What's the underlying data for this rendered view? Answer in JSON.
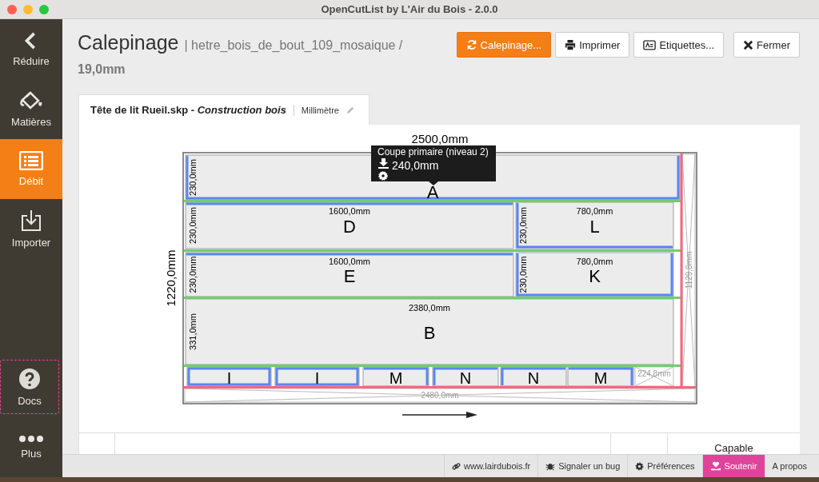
{
  "window": {
    "title": "OpenCutList by L'Air du Bois - 2.0.0"
  },
  "sidebar": {
    "items": [
      {
        "label": "Réduire",
        "kind": "chevron",
        "selected": false,
        "outlined": false
      },
      {
        "label": "Matières",
        "kind": "bucket",
        "selected": false,
        "outlined": false
      },
      {
        "label": "Débit",
        "kind": "list",
        "selected": true,
        "outlined": false
      },
      {
        "label": "Importer",
        "kind": "import",
        "selected": false,
        "outlined": false
      },
      {
        "label": "Docs",
        "kind": "help",
        "selected": false,
        "outlined": true
      },
      {
        "label": "Plus",
        "kind": "dots",
        "selected": false,
        "outlined": false
      }
    ]
  },
  "header": {
    "title": "Calepinage",
    "subtitle": "| hetre_bois_de_bout_109_mosaique /",
    "thickness": "19,0mm"
  },
  "buttons": [
    {
      "label": "Calepinage...",
      "kind": "refresh",
      "primary": true
    },
    {
      "label": "Imprimer",
      "kind": "print",
      "primary": false
    },
    {
      "label": "Etiquettes...",
      "kind": "tag",
      "primary": false
    },
    {
      "label": "Fermer",
      "kind": "close",
      "primary": false
    }
  ],
  "tab": {
    "title": "Tête de lit Rueil.skp - *Construction bois*",
    "units": "Millimètre"
  },
  "diagram": {
    "sheet_length": "2500,0mm",
    "sheet_width": "1220,0mm",
    "parts": [
      {
        "letter": "A",
        "width": "230,0mm",
        "band_top": false,
        "band_right": true,
        "band_bottom": true,
        "band_left": true
      },
      {
        "letter": "D",
        "length": "1600,0mm",
        "width": "230,0mm",
        "band_top": true,
        "band_right": false,
        "band_bottom": false,
        "band_left": false
      },
      {
        "letter": "L",
        "length": "780,0mm",
        "width": "230,0mm",
        "band_top": false,
        "band_right": false,
        "band_bottom": true,
        "band_left": true
      },
      {
        "letter": "E",
        "length": "1600,0mm",
        "width": "230,0mm",
        "band_top": true,
        "band_right": false,
        "band_bottom": false,
        "band_left": false
      },
      {
        "letter": "K",
        "length": "780,0mm",
        "width": "230,0mm",
        "band_top": false,
        "band_right": true,
        "band_bottom": true,
        "band_left": true
      },
      {
        "letter": "B",
        "length": "2380,0mm",
        "width": "331,0mm",
        "band_top": false,
        "band_right": false,
        "band_bottom": false,
        "band_left": false
      },
      {
        "letter": "I",
        "band_top": true,
        "band_right": true,
        "band_bottom": true,
        "band_left": true
      },
      {
        "letter": "I",
        "band_top": true,
        "band_right": true,
        "band_bottom": true,
        "band_left": true
      },
      {
        "letter": "M",
        "band_top": true,
        "band_right": true,
        "band_bottom": false,
        "band_left": false
      },
      {
        "letter": "N",
        "band_top": true,
        "band_right": false,
        "band_bottom": false,
        "band_left": true
      },
      {
        "letter": "N",
        "band_top": true,
        "band_right": false,
        "band_bottom": false,
        "band_left": true
      },
      {
        "letter": "M",
        "band_top": true,
        "band_right": true,
        "band_bottom": false,
        "band_left": false
      }
    ],
    "waste": [
      "224,8mm",
      "1129,8mm",
      "2480,0mm"
    ],
    "tooltip": {
      "title": "Coupe primaire (niveau 2)",
      "value": "240,0mm"
    }
  },
  "table": {
    "cell": "Capable"
  },
  "status_bar": [
    {
      "label": "www.lairdubois.fr",
      "kind": "link",
      "highlighted": false
    },
    {
      "label": "Signaler un bug",
      "kind": "bug",
      "highlighted": false
    },
    {
      "label": "Préférences",
      "kind": "gear",
      "highlighted": false
    },
    {
      "label": "Soutenir",
      "kind": "heart",
      "highlighted": true
    },
    {
      "label": "A propos",
      "kind": "none",
      "highlighted": false
    }
  ]
}
